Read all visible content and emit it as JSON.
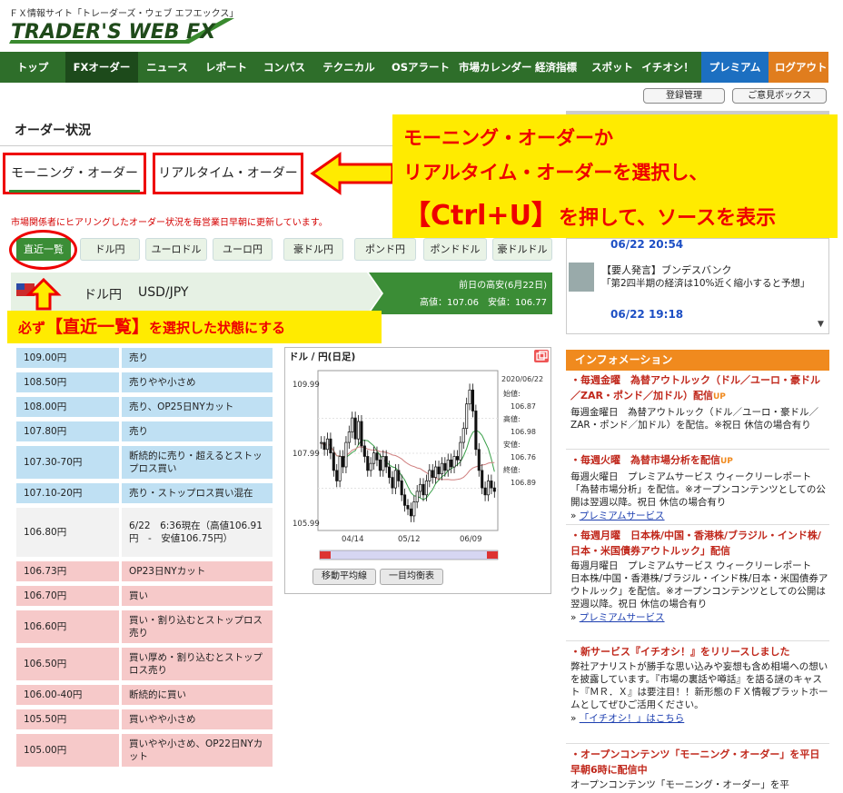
{
  "header": {
    "tagline": "ＦＸ情報サイト「トレーダーズ・ウェブ エフエックス」",
    "logo_text": "TRADER'S WEB FX"
  },
  "nav": [
    {
      "label": "トップ"
    },
    {
      "label": "FXオーダー",
      "active": true
    },
    {
      "label": "ニュース"
    },
    {
      "label": "レポート"
    },
    {
      "label": "コンパス"
    },
    {
      "label": "テクニカル"
    },
    {
      "label": "OSアラート"
    },
    {
      "label": "市場カレンダー"
    },
    {
      "label": "経済指標"
    },
    {
      "label": "スポット"
    },
    {
      "label": "イチオシ！"
    },
    {
      "label": "プレミアム"
    },
    {
      "label": "ログアウト"
    }
  ],
  "subnav": {
    "register": "登録管理",
    "feedback": "ご意見ボックス"
  },
  "page": {
    "section_title": "オーダー状況",
    "tabs": [
      "モーニング・オーダー",
      "リアルタイム・オーダー"
    ],
    "note": "市場関係者にヒアリングしたオーダー状況を毎営業日早朝に更新しています。",
    "pairs": [
      "直近一覧",
      "ドル円",
      "ユーロドル",
      "ユーロ円",
      "豪ドル円",
      "ポンド円",
      "ポンドドル",
      "豪ドルドル"
    ],
    "current_pair": {
      "name": "ドル円",
      "code": "USD/JPY"
    },
    "prev_day": {
      "title": "前日の高安(6月22日)",
      "values": "高値：107.06　安値：106.77"
    }
  },
  "annotations": {
    "bottom_callout": {
      "pre": "必ず",
      "bold": "【直近一覧】",
      "post": "を選択した状態にする"
    },
    "big_callout": {
      "line1": "モーニング・オーダーか",
      "line2": "リアルタイム・オーダーを選択し、",
      "line3_key": "【Ctrl+U】",
      "line3_rest": "を押して、ソースを表示"
    }
  },
  "orders": [
    {
      "price": "109.00円",
      "desc": "売り",
      "kind": "sell",
      "h": 22
    },
    {
      "price": "108.50円",
      "desc": "売りやや小さめ",
      "kind": "sell",
      "h": 22
    },
    {
      "price": "108.00円",
      "desc": "売り、OP25日NYカット",
      "kind": "sell",
      "h": 22
    },
    {
      "price": "107.80円",
      "desc": "売り",
      "kind": "sell",
      "h": 22
    },
    {
      "price": "107.30-70円",
      "desc": "断続的に売り・超えるとストップロス買い",
      "kind": "sell",
      "h": 36
    },
    {
      "price": "107.10-20円",
      "desc": "売り・ストップロス買い混在",
      "kind": "sell",
      "h": 22
    },
    {
      "price": "106.80円",
      "desc": "6/22　6:36現在（高値106.91円　-　安値106.75円）",
      "kind": "now",
      "h": 54
    },
    {
      "price": "106.73円",
      "desc": "OP23日NYカット",
      "kind": "buy",
      "h": 22
    },
    {
      "price": "106.70円",
      "desc": "買い",
      "kind": "buy",
      "h": 22
    },
    {
      "price": "106.60円",
      "desc": "買い・割り込むとストップロス売り",
      "kind": "buy",
      "h": 36
    },
    {
      "price": "106.50円",
      "desc": "買い厚め・割り込むとストップロス売り",
      "kind": "buy",
      "h": 36
    },
    {
      "price": "106.00-40円",
      "desc": "断続的に買い",
      "kind": "buy",
      "h": 22
    },
    {
      "price": "105.50円",
      "desc": "買いやや小さめ",
      "kind": "buy",
      "h": 22
    },
    {
      "price": "105.00円",
      "desc": "買いやや小さめ、OP22日NYカット",
      "kind": "buy",
      "h": 36
    }
  ],
  "chart": {
    "title": "ドル / 円(日足)",
    "y_labels": [
      "109.99",
      "107.99",
      "105.99"
    ],
    "x_labels": [
      "04/14",
      "05/12",
      "06/09"
    ],
    "side": {
      "date": "2020/06/22",
      "open_label": "始値:",
      "open": "106.87",
      "high_label": "高値:",
      "high": "106.98",
      "low_label": "安値:",
      "low": "106.76",
      "close_label": "終値:",
      "close": "106.89"
    },
    "buttons": [
      "移動平均線",
      "一目均衡表"
    ],
    "candles": [
      108.3,
      108.1,
      108.4,
      108.0,
      107.5,
      107.2,
      107.9,
      107.6,
      108.3,
      108.6,
      109.0,
      108.4,
      108.9,
      108.2,
      107.9,
      107.5,
      107.7,
      108.0,
      107.8,
      107.5,
      107.9,
      107.6,
      107.3,
      107.0,
      107.5,
      107.2,
      106.8,
      106.5,
      106.4,
      106.2,
      106.6,
      106.9,
      107.1,
      106.8,
      107.2,
      107.5,
      107.3,
      107.6,
      107.4,
      107.7,
      107.5,
      107.8,
      107.6,
      107.9,
      107.8,
      108.3,
      108.7,
      109.4,
      109.8,
      109.2,
      108.1,
      107.5,
      107.0,
      106.8,
      107.2,
      107.0,
      106.9
    ]
  },
  "news": [
    {
      "time": "06/22 20:54"
    },
    {
      "head": "【要人発言】ブンデスバンク",
      "body": "「第2四半期の経済は10%近く縮小すると予想」",
      "time": "06/22 19:18"
    }
  ],
  "info": {
    "title": "インフォメーション",
    "items": [
      {
        "title": "毎週金曜　為替アウトルック（ドル／ユーロ・豪ドル／ZAR・ポンド／加ドル）配信",
        "badge": "UP",
        "body": "毎週金曜日　為替アウトルック（ドル／ユーロ・豪ドル／ZAR・ポンド／加ドル）を配信。※祝日 休信の場合有り",
        "link": ""
      },
      {
        "title": "毎週火曜　為替市場分析を配信",
        "badge": "UP",
        "body": "毎週火曜日　プレミアムサービス ウィークリーレポート「為替市場分析」を配信。※オープンコンテンツとしての公開は翌週以降。祝日 休信の場合有り",
        "link": "プレミアムサービス"
      },
      {
        "title": "毎週月曜　日本株/中国・香港株/ブラジル・インド株/日本・米国債券アウトルック」配信",
        "badge": "",
        "body": "毎週月曜日　プレミアムサービス ウィークリーレポート　日本株/中国・香港株/ブラジル・インド株/日本・米国債券アウトルック」を配信。※オープンコンテンツとしての公開は翌週以降。祝日 休信の場合有り",
        "link": "プレミアムサービス"
      },
      {
        "title": "新サービス『イチオシ！』をリリースしました",
        "badge": "",
        "body": "弊社アナリストが勝手な思い込みや妄想も含め相場への想いを披露しています。『市場の裏話や噂話』を語る謎のキャスト『ＭＲ．Ｘ』は要注目！！新形態のＦＸ情報プラットホームとしてぜひご活用ください。",
        "link": "「イチオシ！」はこちら"
      },
      {
        "title": "オープンコンテンツ「モーニング・オーダー」を平日早朝6時に配信中",
        "badge": "",
        "body": "オープンコンテンツ「モーニング・オーダー」を平",
        "link": ""
      }
    ]
  },
  "colors": {
    "nav": "#2e6e2a",
    "accent_green": "#3b8d36",
    "sell": "#bfe0f3",
    "buy": "#f6c9c9",
    "callout": "#ffeb00",
    "annotation_red": "#ee0000"
  }
}
